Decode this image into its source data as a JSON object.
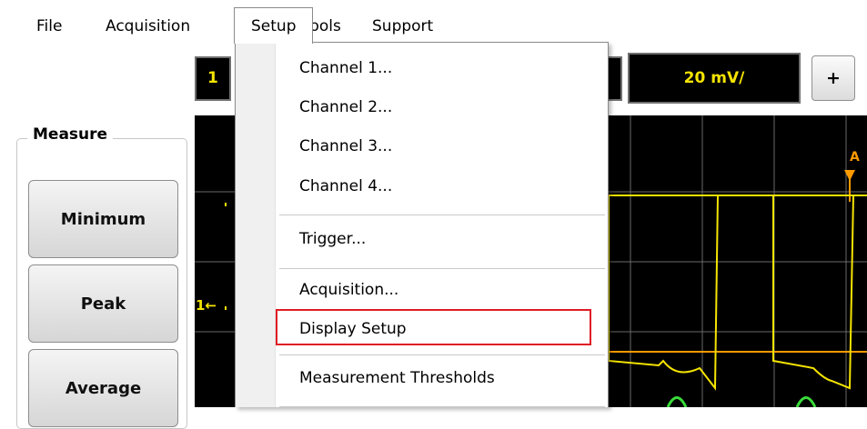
{
  "menubar": {
    "items": [
      "File",
      "Acquisition",
      "Setup",
      "Tools",
      "Support"
    ],
    "active": "Setup"
  },
  "toolbar": {
    "channel_box": "1",
    "scale_value": "20 mV/",
    "plus_label": "+"
  },
  "measure": {
    "title": "Measure",
    "buttons": [
      "Minimum",
      "Peak",
      "Average"
    ]
  },
  "scope": {
    "channel_marker": "1←",
    "marker_label": "A",
    "trace_color": "#f5e400",
    "grid_color": "#6a6a6a",
    "green_trace_color": "#3adb3a",
    "orange_line_color": "#ff9a00"
  },
  "setup_menu": {
    "items": [
      "Channel 1...",
      "Channel 2...",
      "Channel 3...",
      "Channel 4...",
      "Trigger...",
      "Acquisition...",
      "Display Setup",
      "Measurement Thresholds"
    ],
    "highlighted": "Display Setup",
    "highlight_color": "#e01b24"
  }
}
